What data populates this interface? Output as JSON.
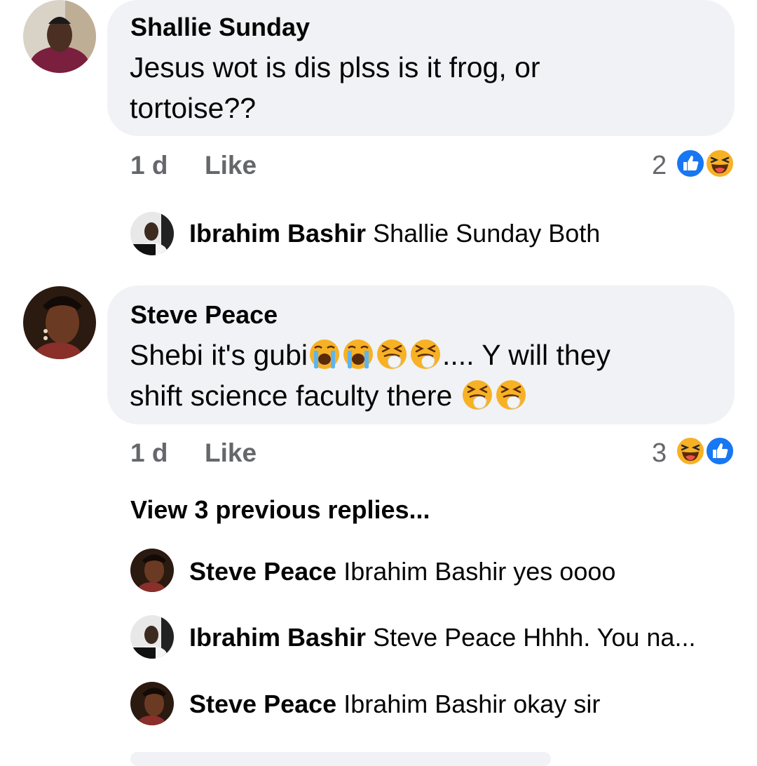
{
  "comments": [
    {
      "author": "Shallie Sunday",
      "text": "Jesus wot is dis plss is it frog, or tortoise??",
      "time": "1 d",
      "like_label": "Like",
      "reaction_count": "2",
      "reactions": [
        "like-icon",
        "laughing-icon"
      ]
    },
    {
      "author": "Steve Peace",
      "text_parts": [
        "Shebi it's gubi",
        ".... Y will they",
        "shift science faculty there"
      ],
      "emojis": [
        "crying-icon",
        "crying-icon",
        "sneezing-icon",
        "sneezing-icon",
        "sneezing-icon",
        "sneezing-icon"
      ],
      "time": "1 d",
      "like_label": "Like",
      "reaction_count": "3",
      "reactions": [
        "laughing-icon",
        "like-icon"
      ]
    }
  ],
  "reply_1": {
    "author": "Ibrahim Bashir",
    "text": "Shallie Sunday Both"
  },
  "view_previous": "View 3 previous replies...",
  "replies_2": [
    {
      "author": "Steve Peace",
      "text": "Ibrahim Bashir yes oooo"
    },
    {
      "author": "Ibrahim Bashir",
      "text": "Steve Peace Hhhh. You na..."
    },
    {
      "author": "Steve Peace",
      "text": "Ibrahim Bashir okay sir"
    }
  ],
  "colors": {
    "bubble": "#f0f2f5",
    "meta": "#65676b",
    "like_blue": "#1877f2",
    "emoji_yellow": "#f7b125"
  }
}
